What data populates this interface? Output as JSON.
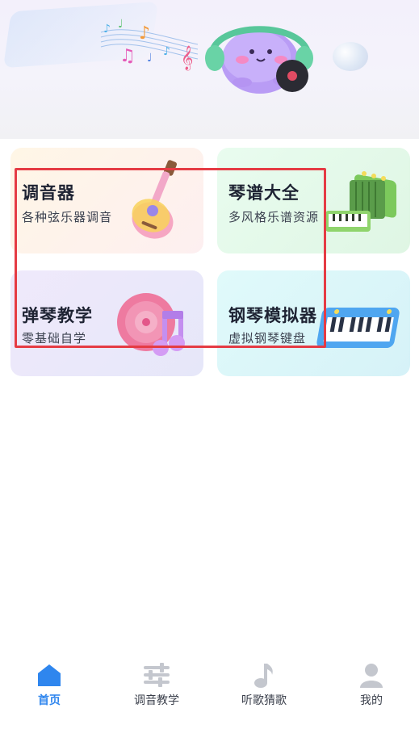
{
  "cards": [
    {
      "title": "调音器",
      "subtitle": "各种弦乐器调音",
      "illustration": "guitar-icon"
    },
    {
      "title": "琴谱大全",
      "subtitle": "多风格乐谱资源",
      "illustration": "accordion-icon"
    },
    {
      "title": "弹琴教学",
      "subtitle": "零基础自学",
      "illustration": "music-disc-icon"
    },
    {
      "title": "钢琴模拟器",
      "subtitle": "虚拟钢琴键盘",
      "illustration": "piano-keyboard-icon"
    }
  ],
  "tabbar": {
    "items": [
      {
        "label": "首页",
        "icon": "home-icon",
        "active": true
      },
      {
        "label": "调音教学",
        "icon": "sliders-icon",
        "active": false
      },
      {
        "label": "听歌猜歌",
        "icon": "music-note-icon",
        "active": false
      },
      {
        "label": "我的",
        "icon": "user-icon",
        "active": false
      }
    ]
  },
  "colors": {
    "accent": "#2f86ee",
    "inactive_icon": "#c4c7ce",
    "highlight_border": "#e53b44"
  }
}
